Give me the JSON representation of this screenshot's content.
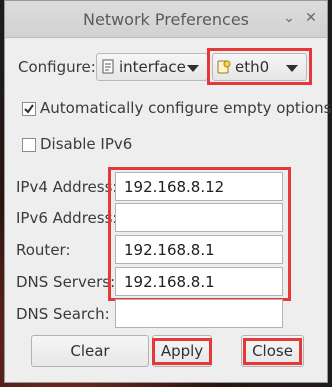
{
  "window": {
    "title": "Network Preferences",
    "minimize_glyph": "⌄",
    "close_glyph": "✕"
  },
  "configure": {
    "label": "Configure:",
    "type_value": "interface",
    "type_icon": "interface-icon",
    "iface_value": "eth0",
    "iface_icon": "network-card-icon"
  },
  "options": {
    "auto_configure": {
      "label": "Automatically configure empty options",
      "checked": true
    },
    "disable_ipv6": {
      "label": "Disable IPv6",
      "checked": false
    }
  },
  "fields": {
    "ipv4": {
      "label": "IPv4 Address:",
      "value": "192.168.8.12"
    },
    "ipv6": {
      "label": "IPv6 Address:",
      "value": ""
    },
    "router": {
      "label": "Router:",
      "value": "192.168.8.1"
    },
    "dns_servers": {
      "label": "DNS Servers:",
      "value": "192.168.8.1"
    },
    "dns_search": {
      "label": "DNS Search:",
      "value": ""
    }
  },
  "buttons": {
    "clear": "Clear",
    "apply": "Apply",
    "close": "Close"
  },
  "highlight_color": "#e53838"
}
